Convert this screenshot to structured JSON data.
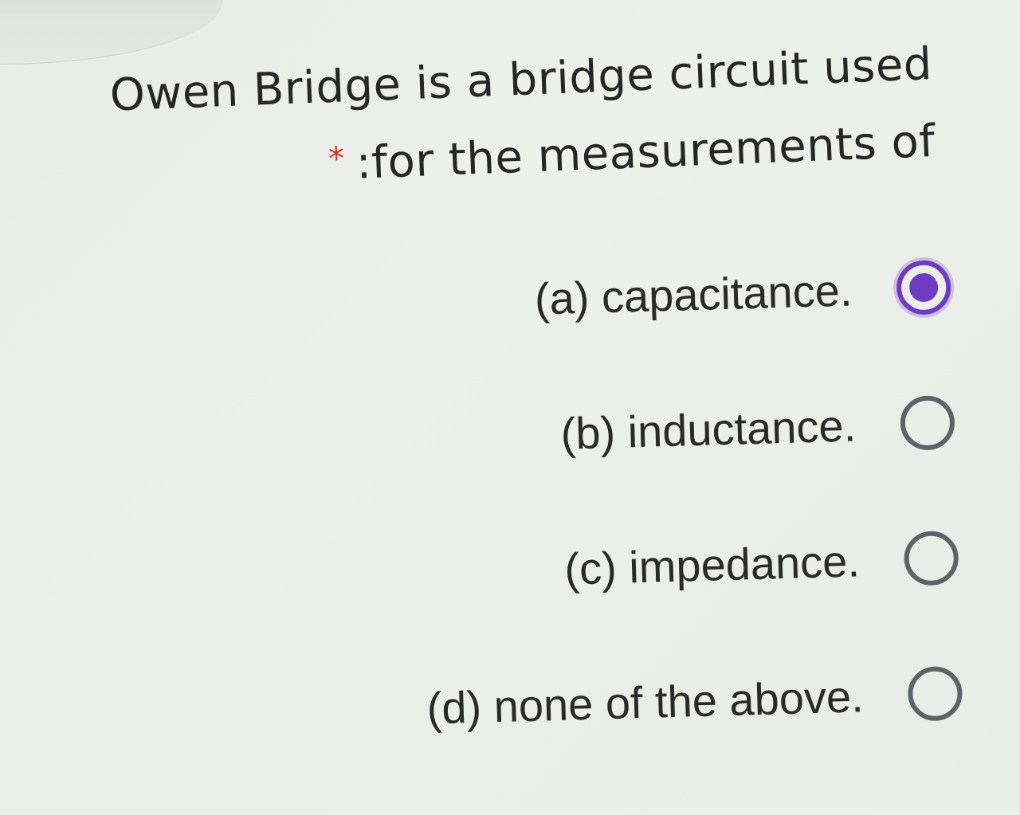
{
  "question": {
    "line1": "Owen Bridge is a bridge circuit used",
    "required_marker": "*",
    "line2": ":for the measurements of"
  },
  "options": [
    {
      "label": "(a) capacitance.",
      "selected": true
    },
    {
      "label": "(b) inductance.",
      "selected": false
    },
    {
      "label": "(c) impedance.",
      "selected": false
    },
    {
      "label": "(d) none of the above.",
      "selected": false
    }
  ],
  "colors": {
    "accent": "#6f3bc2",
    "required": "#d93025",
    "radio_unchecked": "#5f6368",
    "text": "#262626",
    "background": "#eceee9"
  }
}
